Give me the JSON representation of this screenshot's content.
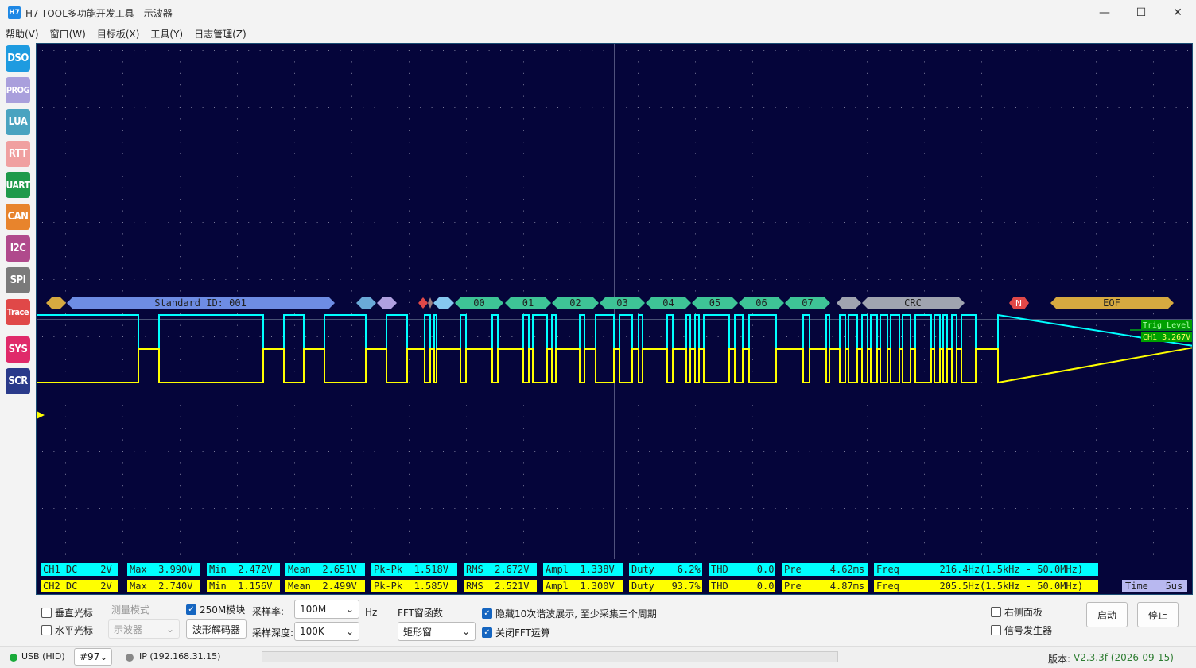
{
  "window": {
    "title": "H7-TOOL多功能开发工具 - 示波器",
    "icon_text": "H7"
  },
  "menu": [
    "帮助(V)",
    "窗口(W)",
    "目标板(X)",
    "工具(Y)",
    "日志管理(Z)"
  ],
  "sidebar": [
    {
      "label": "DSO",
      "color": "#1e9be0"
    },
    {
      "label": "PROG",
      "color": "#a99fdc"
    },
    {
      "label": "LUA",
      "color": "#4aa3c0"
    },
    {
      "label": "RTT",
      "color": "#f0a0a0"
    },
    {
      "label": "UART",
      "color": "#1f9a4a"
    },
    {
      "label": "CAN",
      "color": "#e8842c"
    },
    {
      "label": "I2C",
      "color": "#b04a8c"
    },
    {
      "label": "SPI",
      "color": "#7a7a7a"
    },
    {
      "label": "Trace",
      "color": "#e04848"
    },
    {
      "label": "SYS",
      "color": "#e02a6a"
    },
    {
      "label": "SCR",
      "color": "#2a3a8a"
    }
  ],
  "decoder": {
    "id_label": "Standard ID: 001",
    "data_bytes": [
      "00",
      "01",
      "02",
      "03",
      "04",
      "05",
      "06",
      "07"
    ],
    "crc_label": "CRC",
    "nack_label": "N",
    "eof_label": "EOF"
  },
  "trigger": {
    "level_label": "Trig Level",
    "ch1_label": "CH1 3.267V"
  },
  "ch1": {
    "color": "#00ffff",
    "cells": [
      "CH1 DC    2V",
      "Max  3.990V",
      "Min  2.472V",
      "Mean  2.651V",
      "Pk-Pk  1.518V",
      "RMS  2.672V",
      "Ampl  1.338V",
      "Duty    6.2%",
      "THD     0.0",
      "Pre     4.62ms",
      "Freq       216.4Hz(1.5kHz - 50.0MHz)"
    ]
  },
  "ch2": {
    "color": "#ffff00",
    "cells": [
      "CH2 DC    2V",
      "Max  2.740V",
      "Min  1.156V",
      "Mean  2.499V",
      "Pk-Pk  1.585V",
      "RMS  2.521V",
      "Ampl  1.300V",
      "Duty   93.7%",
      "THD     0.0",
      "Pre     4.87ms",
      "Freq       205.5Hz(1.5kHz - 50.0MHz)"
    ]
  },
  "time_label": "Time   5us",
  "controls": {
    "vcursor": "垂直光标",
    "hcursor": "水平光标",
    "measure_mode": "测量模式",
    "measure_value": "示波器",
    "module_250m": "250M模块",
    "decoder_btn": "波形解码器",
    "sample_rate_label": "采样率:",
    "sample_rate_value": "100M",
    "hz": "Hz",
    "depth_label": "采样深度:",
    "depth_value": "100K",
    "fft_label": "FFT窗函数",
    "fft_value": "矩形窗",
    "hide_harm": "隐藏10次谐波展示, 至少采集三个周期",
    "close_fft": "关闭FFT运算",
    "right_panel": "右侧面板",
    "sig_gen": "信号发生器",
    "start": "启动",
    "stop": "停止"
  },
  "status": {
    "usb": "USB (HID)",
    "device": "#97",
    "ip": "IP (192.168.31.15)",
    "version_label": "版本:",
    "version": "V2.3.3f (2026-09-15)"
  }
}
